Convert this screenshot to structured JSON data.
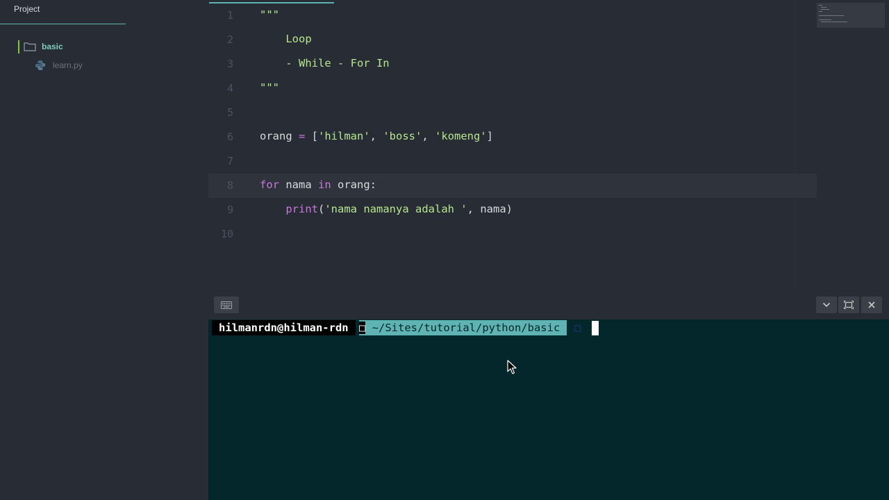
{
  "sidebar": {
    "panel_title": "Project",
    "folder": "basic",
    "file": "learn.py"
  },
  "editor": {
    "lines": [
      {
        "n": "1",
        "parts": [
          {
            "t": "\"\"\"",
            "c": "str"
          }
        ]
      },
      {
        "n": "2",
        "parts": [
          {
            "t": "    Loop",
            "c": "str"
          }
        ]
      },
      {
        "n": "3",
        "parts": [
          {
            "t": "    - While - For In",
            "c": "str"
          }
        ]
      },
      {
        "n": "4",
        "parts": [
          {
            "t": "\"\"\"",
            "c": "str"
          }
        ]
      },
      {
        "n": "5",
        "parts": []
      },
      {
        "n": "6",
        "parts": [
          {
            "t": "orang ",
            "c": ""
          },
          {
            "t": "=",
            "c": "op"
          },
          {
            "t": " [",
            "c": ""
          },
          {
            "t": "'hilman'",
            "c": "str"
          },
          {
            "t": ", ",
            "c": ""
          },
          {
            "t": "'boss'",
            "c": "str"
          },
          {
            "t": ", ",
            "c": ""
          },
          {
            "t": "'komeng'",
            "c": "str"
          },
          {
            "t": "]",
            "c": ""
          }
        ]
      },
      {
        "n": "7",
        "parts": []
      },
      {
        "n": "8",
        "parts": [
          {
            "t": "for",
            "c": "kw"
          },
          {
            "t": " nama ",
            "c": ""
          },
          {
            "t": "in",
            "c": "kw"
          },
          {
            "t": " orang:",
            "c": ""
          }
        ]
      },
      {
        "n": "9",
        "parts": [
          {
            "t": "    ",
            "c": ""
          },
          {
            "t": "print",
            "c": "kw"
          },
          {
            "t": "(",
            "c": ""
          },
          {
            "t": "'nama namanya adalah '",
            "c": "str"
          },
          {
            "t": ", nama)",
            "c": ""
          }
        ]
      },
      {
        "n": "10",
        "parts": []
      }
    ],
    "active_line": "8"
  },
  "terminal": {
    "user_host": "hilmanrdn@hilman-rdn",
    "separator": "□",
    "path": " ~/Sites/tutorial/python/basic",
    "end_glyph": "□"
  },
  "colors": {
    "accent": "#5fb3b3",
    "terminal_bg": "#03272b",
    "editor_bg": "#282c34"
  }
}
